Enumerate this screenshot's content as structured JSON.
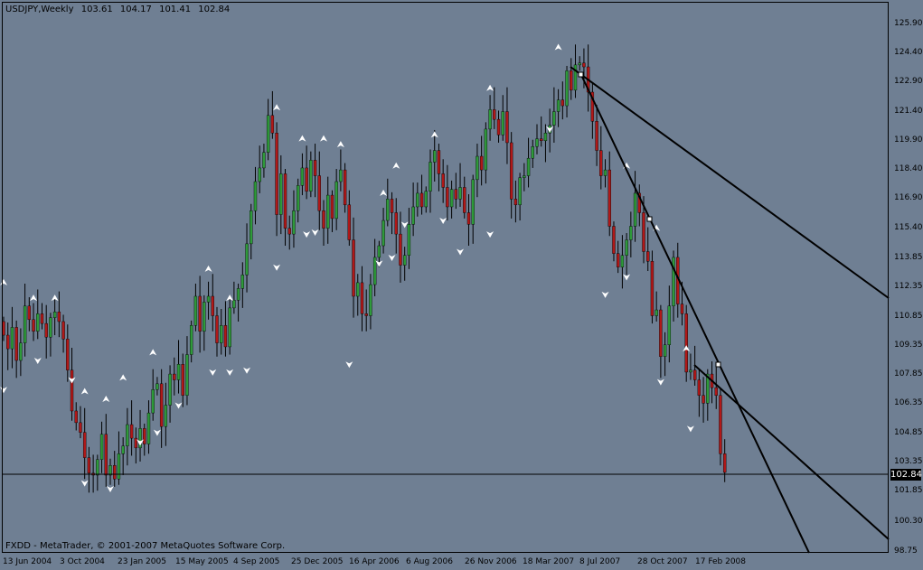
{
  "window": {
    "symbol_period": "USDJPY,Weekly",
    "ohlc": [
      "103.61",
      "104.17",
      "101.41",
      "102.84"
    ],
    "copyright": "FXDD - MetaTrader, © 2001-2007 MetaQuotes Software Corp.",
    "current_price": "102.84"
  },
  "colors": {
    "background": "#6f7f93",
    "bull": "#2e9a3a",
    "bear": "#b01818",
    "fractal": "#ffffff",
    "lines": "#000000"
  },
  "chart_data": {
    "type": "candlestick",
    "symbol": "USDJPY",
    "timeframe": "Weekly",
    "ylim": [
      98.75,
      127.0
    ],
    "y_ticks": [
      "125.90",
      "124.40",
      "122.90",
      "121.40",
      "119.90",
      "118.40",
      "116.90",
      "115.40",
      "113.85",
      "112.35",
      "110.85",
      "109.35",
      "107.85",
      "106.35",
      "104.85",
      "103.35",
      "101.85",
      "100.30",
      "98.75"
    ],
    "x_ticks": [
      "13 Jun 2004",
      "3 Oct 2004",
      "23 Jan 2005",
      "15 May 2005",
      "4 Sep 2005",
      "25 Dec 2005",
      "16 Apr 2006",
      "6 Aug 2006",
      "26 Nov 2006",
      "18 Mar 2007",
      "8 Jul 2007",
      "28 Oct 2007",
      "17 Feb 2008"
    ],
    "bid_line": 102.84,
    "closes": [
      109.9,
      109.2,
      110.3,
      108.6,
      109.5,
      111.4,
      110.7,
      110.1,
      111.0,
      110.5,
      109.8,
      110.8,
      111.1,
      110.6,
      109.7,
      108.1,
      106.0,
      105.4,
      104.9,
      103.6,
      102.8,
      102.7,
      103.5,
      104.8,
      102.7,
      103.2,
      102.5,
      103.8,
      104.2,
      105.3,
      104.6,
      104.1,
      105.1,
      104.3,
      105.9,
      107.1,
      107.4,
      105.2,
      106.3,
      107.9,
      107.6,
      108.4,
      106.8,
      108.9,
      110.4,
      111.9,
      110.1,
      111.6,
      111.9,
      110.9,
      109.5,
      110.4,
      109.3,
      111.3,
      111.7,
      112.3,
      113.0,
      114.6,
      116.3,
      117.8,
      118.5,
      119.3,
      121.2,
      120.3,
      116.1,
      118.2,
      115.4,
      115.1,
      116.3,
      117.6,
      118.5,
      117.3,
      118.9,
      118.1,
      116.3,
      115.4,
      117.1,
      115.9,
      117.8,
      118.4,
      116.6,
      114.8,
      111.9,
      112.6,
      111.0,
      110.9,
      112.5,
      113.9,
      114.5,
      115.8,
      116.9,
      116.2,
      115.1,
      113.5,
      114.0,
      115.6,
      116.5,
      117.2,
      116.5,
      117.3,
      118.8,
      119.4,
      118.2,
      117.5,
      116.5,
      117.4,
      116.9,
      117.5,
      116.2,
      115.6,
      117.9,
      119.1,
      118.4,
      120.5,
      121.5,
      121.0,
      120.2,
      121.4,
      119.8,
      116.9,
      116.6,
      118.0,
      118.1,
      119.0,
      119.6,
      120.0,
      119.9,
      120.3,
      120.7,
      121.4,
      122.0,
      121.7,
      123.5,
      122.5,
      123.8,
      123.9,
      123.7,
      122.4,
      120.9,
      119.4,
      118.1,
      118.4,
      115.5,
      114.1,
      113.4,
      114.0,
      114.8,
      115.5,
      117.2,
      116.2,
      114.2,
      113.7,
      110.9,
      111.2,
      108.8,
      109.4,
      111.4,
      113.9,
      111.5,
      111.0,
      108.0,
      108.1,
      107.6,
      106.8,
      106.4,
      107.9,
      107.2,
      106.8,
      103.8,
      102.84
    ]
  },
  "fractals": {
    "up": [
      [
        0,
        112.6
      ],
      [
        7,
        111.8
      ],
      [
        12,
        111.8
      ],
      [
        19,
        107.0
      ],
      [
        24,
        106.6
      ],
      [
        28,
        107.7
      ],
      [
        35,
        109.0
      ],
      [
        48,
        113.3
      ],
      [
        53,
        111.8
      ],
      [
        64,
        121.6
      ],
      [
        70,
        120.0
      ],
      [
        75,
        120.0
      ],
      [
        79,
        119.7
      ],
      [
        89,
        117.2
      ],
      [
        92,
        118.6
      ],
      [
        101,
        120.2
      ],
      [
        114,
        122.6
      ],
      [
        130,
        124.7
      ],
      [
        146,
        118.6
      ],
      [
        153,
        115.4
      ],
      [
        160,
        109.2
      ]
    ],
    "down": [
      [
        0,
        107.1
      ],
      [
        8,
        108.6
      ],
      [
        16,
        107.6
      ],
      [
        19,
        102.3
      ],
      [
        25,
        102.0
      ],
      [
        32,
        104.4
      ],
      [
        36,
        104.9
      ],
      [
        41,
        106.3
      ],
      [
        49,
        108.0
      ],
      [
        53,
        108.0
      ],
      [
        57,
        108.1
      ],
      [
        64,
        113.4
      ],
      [
        71,
        115.1
      ],
      [
        73,
        115.2
      ],
      [
        81,
        108.4
      ],
      [
        88,
        113.6
      ],
      [
        91,
        113.9
      ],
      [
        94,
        115.6
      ],
      [
        103,
        115.8
      ],
      [
        107,
        114.2
      ],
      [
        114,
        115.1
      ],
      [
        128,
        120.5
      ],
      [
        141,
        112.0
      ],
      [
        146,
        112.9
      ],
      [
        154,
        107.5
      ],
      [
        161,
        105.1
      ]
    ]
  }
}
